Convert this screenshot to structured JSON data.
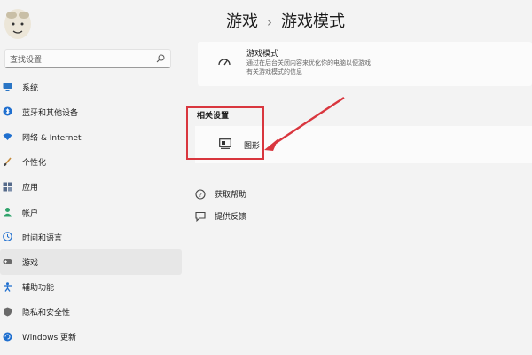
{
  "breadcrumb": {
    "parent": "游戏",
    "separator": "›",
    "current": "游戏模式"
  },
  "search": {
    "placeholder": "查找设置"
  },
  "nav": [
    {
      "label": "系统",
      "icon": "monitor-icon",
      "color": "#2a75c5"
    },
    {
      "label": "蓝牙和其他设备",
      "icon": "bluetooth-icon",
      "color": "#1f6fcf"
    },
    {
      "label": "网络 & Internet",
      "icon": "wifi-icon",
      "color": "#1f6fcf"
    },
    {
      "label": "个性化",
      "icon": "brush-icon",
      "color": "#c58a3a"
    },
    {
      "label": "应用",
      "icon": "apps-icon",
      "color": "#556a8a"
    },
    {
      "label": "帐户",
      "icon": "account-icon",
      "color": "#2fa36b"
    },
    {
      "label": "时间和语言",
      "icon": "globe-clock-icon",
      "color": "#1f6fcf"
    },
    {
      "label": "游戏",
      "icon": "gamepad-icon",
      "color": "#6a6a6a",
      "active": true
    },
    {
      "label": "辅助功能",
      "icon": "accessibility-icon",
      "color": "#1f6fcf"
    },
    {
      "label": "隐私和安全性",
      "icon": "shield-icon",
      "color": "#6a6a6a"
    },
    {
      "label": "Windows 更新",
      "icon": "windows-update-icon",
      "color": "#1f6fcf"
    }
  ],
  "game_mode_card": {
    "title": "游戏模式",
    "desc_line1": "通过在后台关闭内容来优化你的电脑以便游戏",
    "desc_line2": "有关游戏模式的信息",
    "icon": "speedometer-icon"
  },
  "related": {
    "heading": "相关设置",
    "item_label": "图形",
    "item_icon": "graphics-icon"
  },
  "links": [
    {
      "label": "获取帮助",
      "icon": "help-icon"
    },
    {
      "label": "提供反馈",
      "icon": "feedback-icon"
    }
  ],
  "colors": {
    "accent": "#1f6fcf",
    "annotation": "#d9363e"
  }
}
